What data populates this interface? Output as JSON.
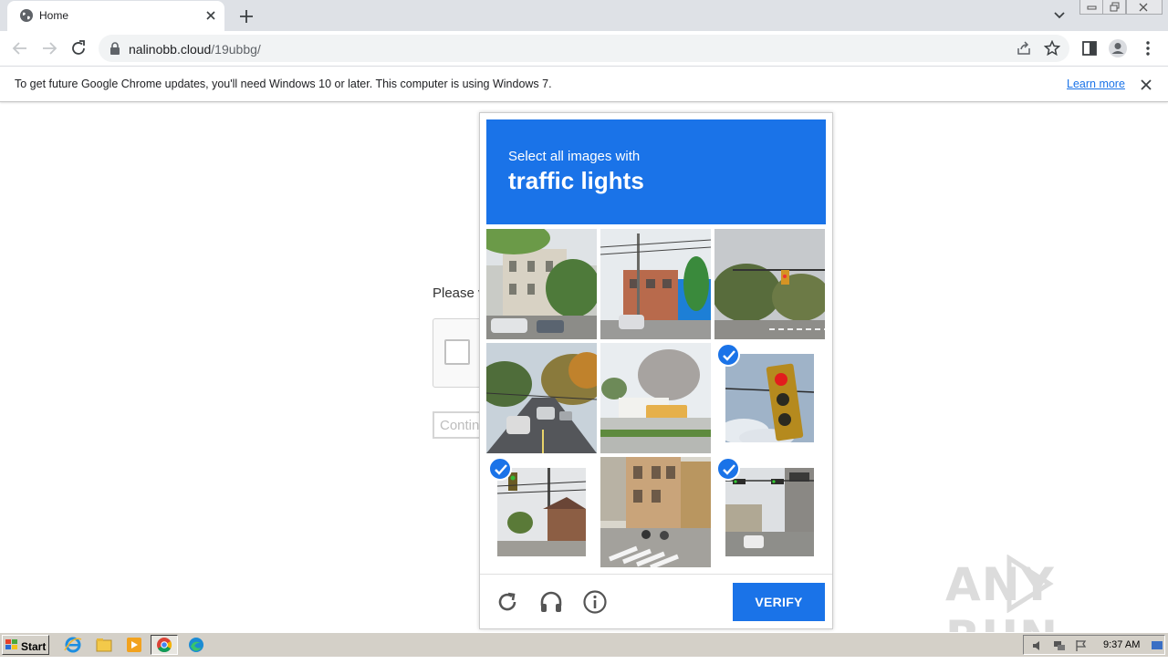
{
  "browser": {
    "tab_title": "Home",
    "url_host": "nalinobb.cloud",
    "url_path": "/19ubbg/"
  },
  "infobar": {
    "message": "To get future Google Chrome updates, you'll need Windows 10 or later. This computer is using Windows 7.",
    "link_label": "Learn more"
  },
  "page": {
    "prompt_text": "Please v",
    "continue_label": "Contin"
  },
  "captcha": {
    "instruction": "Select all images with",
    "target": "traffic lights",
    "verify_label": "VERIFY",
    "accent_color": "#1a73e8",
    "tiles": [
      {
        "scene": "street-building",
        "selected": false
      },
      {
        "scene": "street-poles",
        "selected": false
      },
      {
        "scene": "intersection-signal",
        "selected": false
      },
      {
        "scene": "road-cars",
        "selected": false
      },
      {
        "scene": "trees-bus",
        "selected": false
      },
      {
        "scene": "traffic-light-closeup",
        "selected": true
      },
      {
        "scene": "traffic-light-house",
        "selected": true
      },
      {
        "scene": "crosswalk-buildings",
        "selected": false
      },
      {
        "scene": "intersection-street",
        "selected": true
      }
    ],
    "controls": [
      "reload-icon",
      "audio-icon",
      "info-icon"
    ]
  },
  "watermark": {
    "left": "ANY",
    "right": "RUN"
  },
  "taskbar": {
    "start_label": "Start",
    "apps": [
      "ie-icon",
      "explorer-icon",
      "media-player-icon",
      "chrome-icon",
      "edge-icon"
    ],
    "clock": "9:37 AM"
  }
}
